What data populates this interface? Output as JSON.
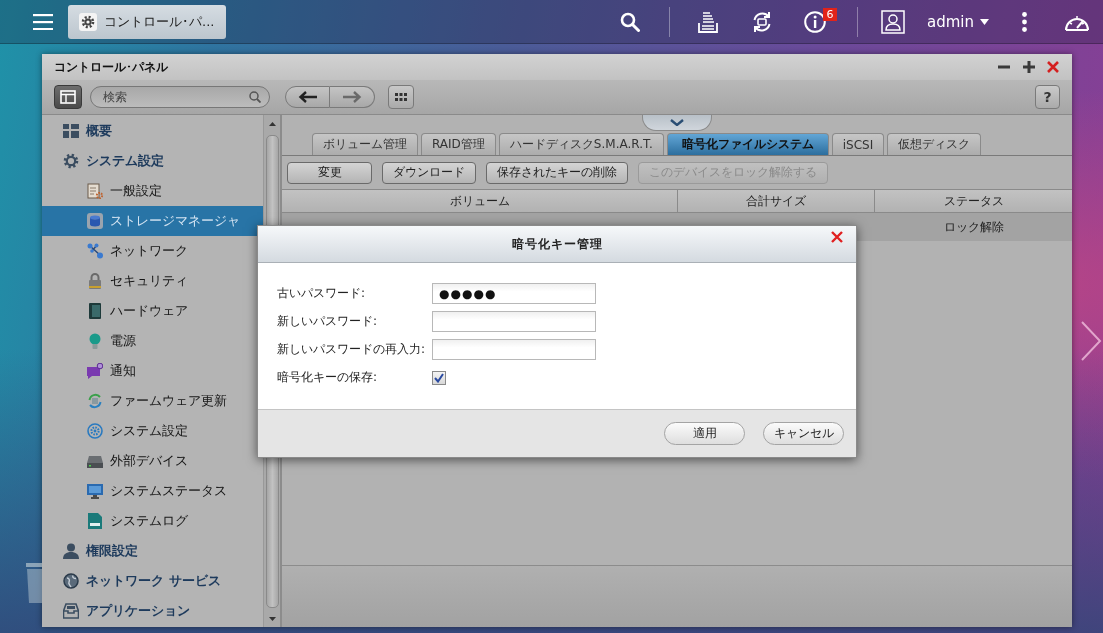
{
  "top_bar": {
    "app_tab": {
      "label": "コントロール･パ..."
    },
    "notification_count": "6",
    "user_name": "admin"
  },
  "window": {
    "title": "コントロール･パネル",
    "search": {
      "placeholder": "検索"
    },
    "help_button": "?"
  },
  "sidebar": {
    "items": [
      {
        "label": "概要",
        "selected": false
      },
      {
        "label": "システム設定",
        "selected": false,
        "children": [
          {
            "label": "一般設定",
            "selected": false
          },
          {
            "label": "ストレージマネージャ",
            "selected": true
          },
          {
            "label": "ネットワーク",
            "selected": false
          },
          {
            "label": "セキュリティ",
            "selected": false
          },
          {
            "label": "ハードウェア",
            "selected": false
          },
          {
            "label": "電源",
            "selected": false
          },
          {
            "label": "通知",
            "selected": false
          },
          {
            "label": "ファームウェア更新",
            "selected": false
          },
          {
            "label": "システム設定",
            "selected": false
          },
          {
            "label": "外部デバイス",
            "selected": false
          },
          {
            "label": "システムステータス",
            "selected": false
          },
          {
            "label": "システムログ",
            "selected": false
          }
        ]
      },
      {
        "label": "権限設定",
        "selected": false
      },
      {
        "label": "ネットワーク サービス",
        "selected": false
      },
      {
        "label": "アプリケーション",
        "selected": false
      }
    ]
  },
  "tabs": [
    {
      "label": "ボリューム管理",
      "selected": false
    },
    {
      "label": "RAID管理",
      "selected": false
    },
    {
      "label": "ハードディスクS.M.A.R.T.",
      "selected": false
    },
    {
      "label": "暗号化ファイルシステム",
      "selected": true
    },
    {
      "label": "iSCSI",
      "selected": false
    },
    {
      "label": "仮想ディスク",
      "selected": false
    }
  ],
  "toolbar_buttons": [
    {
      "label": "変更",
      "disabled": false
    },
    {
      "label": "ダウンロード",
      "disabled": false
    },
    {
      "label": "保存されたキーの削除",
      "disabled": false
    },
    {
      "label": "このデバイスをロック解除する",
      "disabled": true
    }
  ],
  "table": {
    "columns": [
      "ボリューム",
      "合計サイズ",
      "ステータス"
    ],
    "rows": [
      {
        "status": "ロック解除",
        "selected": true
      }
    ]
  },
  "dialog": {
    "title": "暗号化キー管理",
    "fields": [
      {
        "kind": "password",
        "label": "古いパスワード:",
        "value": "●●●●●"
      },
      {
        "kind": "password",
        "label": "新しいパスワード:"
      },
      {
        "kind": "password",
        "label": "新しいパスワードの再入力:"
      },
      {
        "kind": "checkbox",
        "label": "暗号化キーの保存:",
        "checked": true
      }
    ],
    "buttons": [
      "適用",
      "キャンセル"
    ]
  }
}
